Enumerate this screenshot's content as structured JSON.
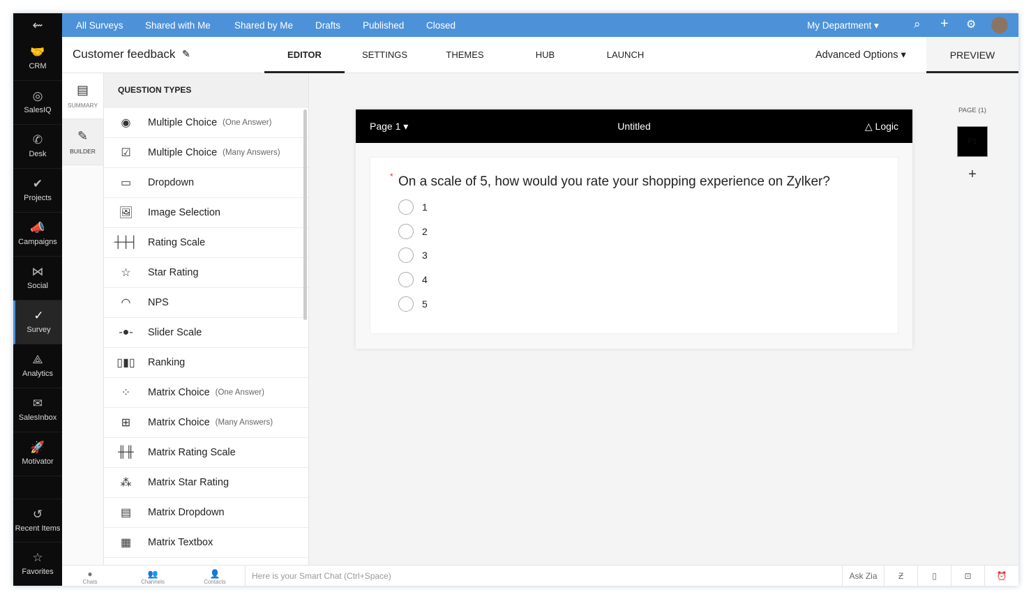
{
  "sidebar": {
    "items": [
      {
        "label": "CRM",
        "icon": "handshake-icon"
      },
      {
        "label": "SalesIQ",
        "icon": "target-icon"
      },
      {
        "label": "Desk",
        "icon": "desk-icon"
      },
      {
        "label": "Projects",
        "icon": "check-icon"
      },
      {
        "label": "Campaigns",
        "icon": "megaphone-icon"
      },
      {
        "label": "Social",
        "icon": "share-icon"
      },
      {
        "label": "Survey",
        "icon": "check-circle-icon",
        "active": true
      },
      {
        "label": "Analytics",
        "icon": "analytics-icon"
      },
      {
        "label": "SalesInbox",
        "icon": "inbox-icon"
      },
      {
        "label": "Motivator",
        "icon": "rocket-icon"
      }
    ],
    "recent": "Recent Items",
    "favorites": "Favorites"
  },
  "topnav": {
    "items": [
      "All Surveys",
      "Shared with Me",
      "Shared by Me",
      "Drafts",
      "Published",
      "Closed"
    ],
    "department": "My Department"
  },
  "header": {
    "title": "Customer feedback",
    "tabs": [
      "EDITOR",
      "SETTINGS",
      "THEMES",
      "HUB",
      "LAUNCH"
    ],
    "active_tab": "EDITOR",
    "advanced": "Advanced Options",
    "preview": "PREVIEW"
  },
  "builder": {
    "summary": "SUMMARY",
    "builder": "BUILDER"
  },
  "question_types": {
    "title": "QUESTION TYPES",
    "items": [
      {
        "label": "Multiple Choice",
        "note": "(One Answer)",
        "icon": "◉"
      },
      {
        "label": "Multiple Choice",
        "note": "(Many Answers)",
        "icon": "☑"
      },
      {
        "label": "Dropdown",
        "note": "",
        "icon": "▭"
      },
      {
        "label": "Image Selection",
        "note": "",
        "icon": "🖼"
      },
      {
        "label": "Rating Scale",
        "note": "",
        "icon": "┼┼┤"
      },
      {
        "label": "Star Rating",
        "note": "",
        "icon": "☆"
      },
      {
        "label": "NPS",
        "note": "",
        "icon": "◠"
      },
      {
        "label": "Slider Scale",
        "note": "",
        "icon": "-●-"
      },
      {
        "label": "Ranking",
        "note": "",
        "icon": "▯▮▯"
      },
      {
        "label": "Matrix Choice",
        "note": "(One Answer)",
        "icon": "⁘"
      },
      {
        "label": "Matrix Choice",
        "note": "(Many Answers)",
        "icon": "⊞"
      },
      {
        "label": "Matrix Rating Scale",
        "note": "",
        "icon": "╫╫"
      },
      {
        "label": "Matrix Star Rating",
        "note": "",
        "icon": "⁂"
      },
      {
        "label": "Matrix Dropdown",
        "note": "",
        "icon": "▤"
      },
      {
        "label": "Matrix Textbox",
        "note": "",
        "icon": "▦"
      }
    ]
  },
  "page": {
    "label": "Page 1",
    "title": "Untitled",
    "logic": "Logic",
    "question": "On a scale of 5, how would you rate your shopping experience on Zylker?",
    "required": "*",
    "options": [
      "1",
      "2",
      "3",
      "4",
      "5"
    ]
  },
  "pages_panel": {
    "label": "PAGE (1)",
    "thumb": "P1",
    "add": "+"
  },
  "bottom": {
    "chats": "Chats",
    "channels": "Channels",
    "contacts": "Contacts",
    "placeholder": "Here is your Smart Chat (Ctrl+Space)",
    "ask_zia": "Ask Zia"
  }
}
